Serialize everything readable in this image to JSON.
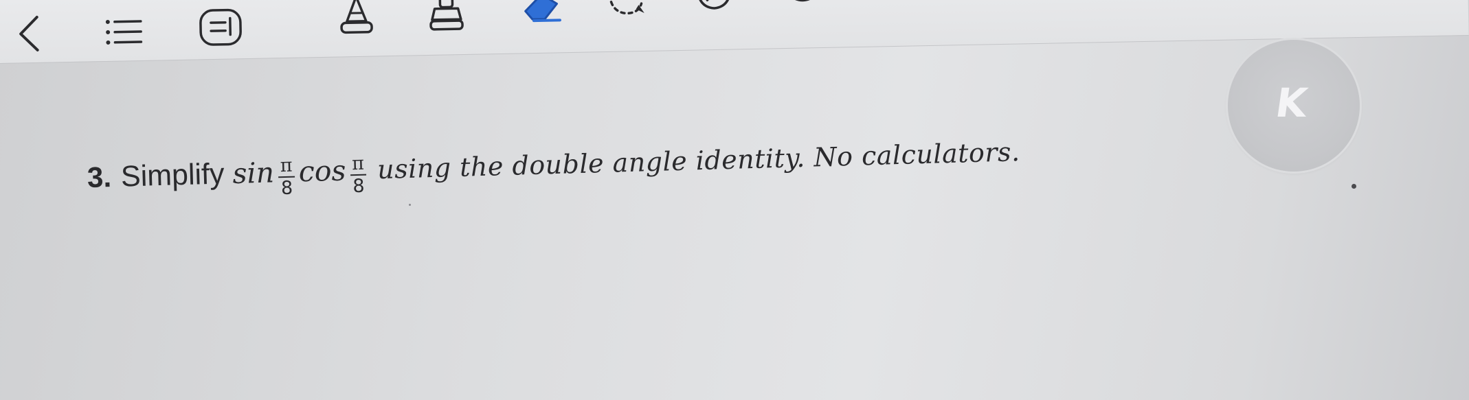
{
  "toolbar": {
    "items": [
      {
        "id": "back",
        "icon": "chevron-left-icon"
      },
      {
        "id": "list",
        "icon": "list-icon"
      },
      {
        "id": "menu",
        "icon": "menu-box-icon"
      },
      {
        "id": "highlighter",
        "icon": "highlighter-icon"
      },
      {
        "id": "stamp",
        "icon": "stamp-icon"
      },
      {
        "id": "eraser",
        "icon": "eraser-icon"
      },
      {
        "id": "lasso",
        "icon": "lasso-icon"
      },
      {
        "id": "shape",
        "icon": "shape-icon"
      },
      {
        "id": "timer",
        "icon": "timer-icon"
      },
      {
        "id": "more",
        "icon": "more-icon"
      }
    ]
  },
  "problem": {
    "number": "3.",
    "verb": "Simplify",
    "fn1": "sin",
    "frac1_num": "π",
    "frac1_den": "8",
    "fn2": "cos",
    "frac2_num": "π",
    "frac2_den": "8",
    "rest": "using the double angle identity. No calculators."
  },
  "floating_button": {
    "letter": "K"
  },
  "colors": {
    "text": "#2a2a2d",
    "toolbar": "#e6e7e9",
    "page": "#dcdddf",
    "floating_button": "#c6c7ca",
    "accent_blue": "#2f6fd6"
  }
}
